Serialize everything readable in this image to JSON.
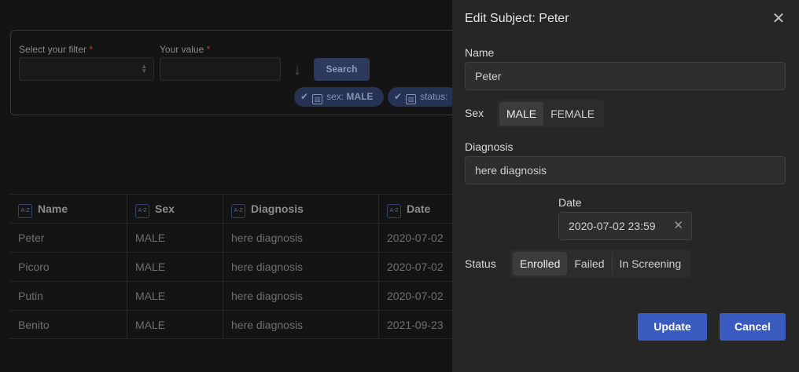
{
  "filter": {
    "filter_label": "Select your filter",
    "value_label": "Your value",
    "required_mark": "*",
    "search_button": "Search",
    "chips": [
      {
        "key": "sex:",
        "value": "MALE"
      },
      {
        "key": "status:",
        "value": ""
      }
    ]
  },
  "table": {
    "sort_icon_text": "A-Z",
    "columns": [
      "Name",
      "Sex",
      "Diagnosis",
      "Date"
    ],
    "rows": [
      [
        "Peter",
        "MALE",
        "here diagnosis",
        "2020-07-02"
      ],
      [
        "Picoro",
        "MALE",
        "here diagnosis",
        "2020-07-02"
      ],
      [
        "Putin",
        "MALE",
        "here diagnosis",
        "2020-07-02"
      ],
      [
        "Benito",
        "MALE",
        "here diagnosis",
        "2021-09-23"
      ]
    ]
  },
  "drawer": {
    "title": "Edit Subject: Peter",
    "name_label": "Name",
    "name_value": "Peter",
    "sex_label": "Sex",
    "sex_options": [
      "MALE",
      "FEMALE"
    ],
    "sex_selected": "MALE",
    "diagnosis_label": "Diagnosis",
    "diagnosis_value": "here diagnosis",
    "date_label": "Date",
    "date_value": "2020-07-02 23:59",
    "status_label": "Status",
    "status_options": [
      "Enrolled",
      "Failed",
      "In Screening"
    ],
    "status_selected": "Enrolled",
    "update_button": "Update",
    "cancel_button": "Cancel"
  },
  "colors": {
    "accent": "#3a5bbf",
    "drawer_bg": "#262626",
    "page_bg": "#141414"
  },
  "icons": {
    "close": "close-icon",
    "sort": "sort-az-icon",
    "check": "check-icon",
    "trash": "trash-icon",
    "arrow": "arrow-down-icon",
    "clear": "clear-icon"
  }
}
